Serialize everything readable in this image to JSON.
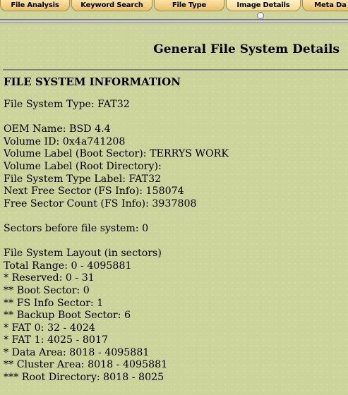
{
  "tabs": [
    {
      "label": "File Analysis"
    },
    {
      "label": "Keyword Search"
    },
    {
      "label": "File Type"
    },
    {
      "label": "Image Details"
    },
    {
      "label": "Meta Da"
    }
  ],
  "page_title": "General File System Details",
  "section_heading": "FILE SYSTEM INFORMATION",
  "details": [
    "File System Type: FAT32",
    "",
    "OEM Name: BSD 4.4",
    "Volume ID: 0x4a741208",
    "Volume Label (Boot Sector): TERRYS WORK",
    "Volume Label (Root Directory):",
    "File System Type Label: FAT32",
    "Next Free Sector (FS Info): 158074",
    "Free Sector Count (FS Info): 3937808",
    "",
    "Sectors before file system: 0",
    "",
    "File System Layout (in sectors)",
    "Total Range: 0 - 4095881",
    "* Reserved: 0 - 31",
    "** Boot Sector: 0",
    "** FS Info Sector: 1",
    "** Backup Boot Sector: 6",
    "* FAT 0: 32 - 4024",
    "* FAT 1: 4025 - 8017",
    "* Data Area: 8018 - 4095881",
    "** Cluster Area: 8018 - 4095881",
    "*** Root Directory: 8018 - 8025"
  ]
}
